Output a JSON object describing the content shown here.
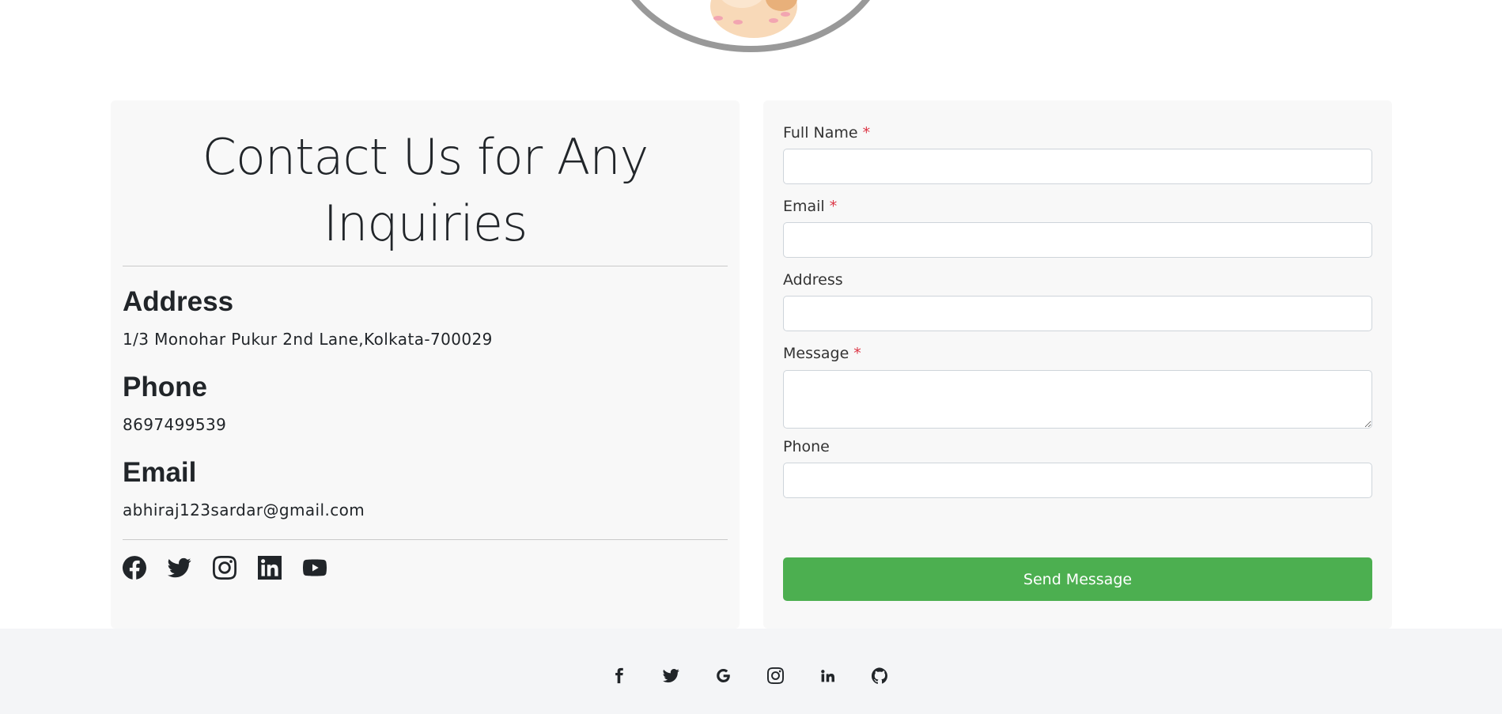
{
  "contact": {
    "title": "Contact Us for Any Inquiries",
    "address_heading": "Address",
    "address_value": "1/3 Monohar Pukur 2nd Lane,Kolkata-700029",
    "phone_heading": "Phone",
    "phone_value": "8697499539",
    "email_heading": "Email",
    "email_value": "abhiraj123sardar@gmail.com",
    "social_icons": [
      "facebook-icon",
      "twitter-icon",
      "instagram-icon",
      "linkedin-icon",
      "youtube-icon"
    ]
  },
  "form": {
    "full_name_label": "Full Name",
    "email_label": "Email",
    "address_label": "Address",
    "message_label": "Message",
    "phone_label": "Phone",
    "required_mark": "*",
    "full_name_value": "",
    "email_value": "",
    "address_value": "",
    "message_value": "",
    "phone_value": "",
    "send_label": "Send Message"
  },
  "footer": {
    "icons": [
      "facebook-icon",
      "twitter-icon",
      "google-icon",
      "instagram-icon",
      "linkedin-icon",
      "github-icon"
    ]
  },
  "colors": {
    "accent": "#4caf50",
    "required": "#dc3545",
    "card_bg": "#f8f8f8",
    "footer_bg": "#f4f5f7",
    "text": "#212529"
  }
}
